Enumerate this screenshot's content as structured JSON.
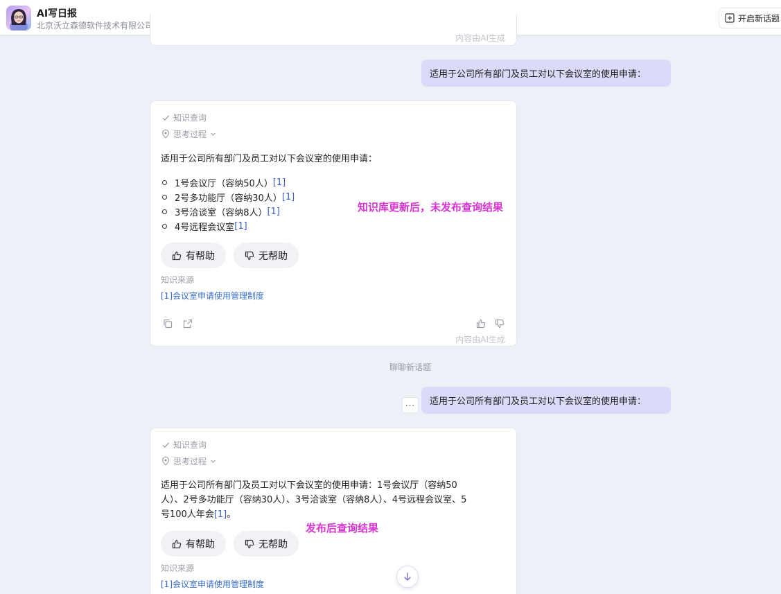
{
  "header": {
    "title": "AI写日报",
    "subtitle": "北京沃立森德软件技术有限公司",
    "new_topic_label": "开启新话题"
  },
  "ai_generated_note": "内容由AI生成",
  "conversation": {
    "user_message_1": "适用于公司所有部门及员工对以下会议室的使用申请：",
    "answer_1": {
      "status": "知识查询",
      "thinking": "思考过程",
      "intro": "适用于公司所有部门及员工对以下会议室的使用申请：",
      "items": [
        {
          "text": "1号会议厅（容纳50人）",
          "cite": "[1]"
        },
        {
          "text": "2号多功能厅（容纳30人）",
          "cite": "[1]"
        },
        {
          "text": "3号洽谈室（容纳8人）",
          "cite": "[1]"
        },
        {
          "text": "4号远程会议室",
          "cite": "[1]"
        }
      ],
      "helpful_label": "有帮助",
      "unhelpful_label": "无帮助",
      "source_label": "知识来源",
      "source_link": "[1]会议室申请使用管理制度"
    },
    "divider_label": "聊聊新话题",
    "more_label": "···",
    "user_message_2": "适用于公司所有部门及员工对以下会议室的使用申请：",
    "answer_2": {
      "status": "知识查询",
      "thinking": "思考过程",
      "text_line1": "适用于公司所有部门及员工对以下会议室的使用申请：1号会议厅（容纳50",
      "text_line2": "人）、2号多功能厅（容纳30人）、3号洽谈室（容纳8人）、4号远程会议室、5",
      "text_line3": "号100人年会",
      "text_cite": "[1]",
      "text_end": "。",
      "helpful_label": "有帮助",
      "unhelpful_label": "无帮助",
      "source_label": "知识来源",
      "source_link": "[1]会议室申请使用管理制度"
    }
  },
  "annotations": {
    "before_publish": "知识库更新后，未发布查询结果",
    "after_publish": "发布后查询结果"
  },
  "colors": {
    "user_bubble": "#dcdaf9",
    "annotation": "#d633d0",
    "link": "#3a6fc9"
  }
}
